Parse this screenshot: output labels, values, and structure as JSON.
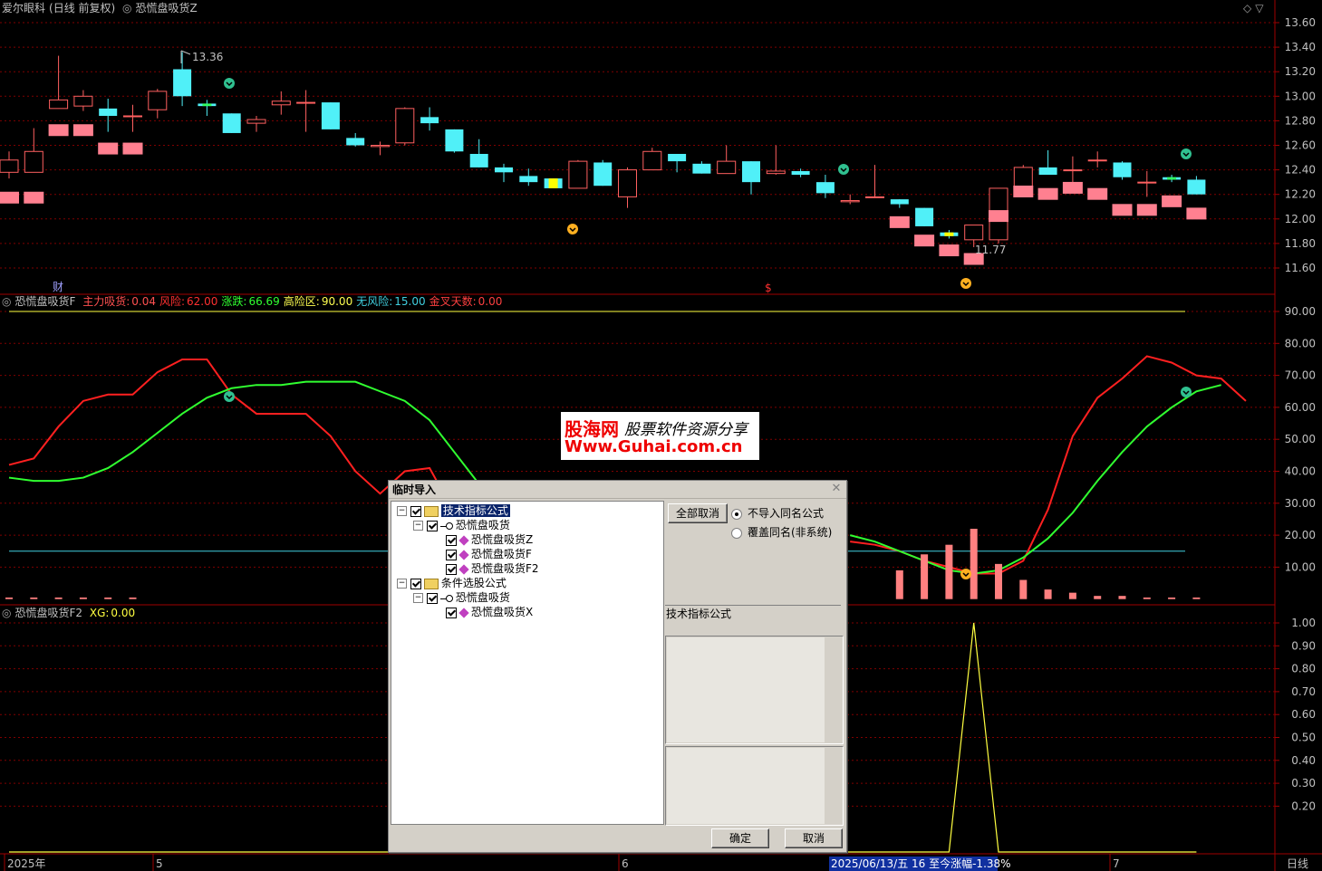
{
  "panel1": {
    "stock": "爱尔眼科",
    "mode": "(日线 前复权)",
    "indicator": "恐慌盘吸货Z",
    "high_label": "13.36",
    "low_label": "11.77",
    "marker_cai": "财",
    "marker_s": "$",
    "y_ticks": [
      "13.60",
      "13.40",
      "13.20",
      "13.00",
      "12.80",
      "12.60",
      "12.40",
      "12.20",
      "12.00",
      "11.80",
      "11.60"
    ]
  },
  "panel2": {
    "indicator": "恐慌盘吸货F",
    "items": [
      {
        "label": "主力吸货:",
        "value": "0.04",
        "color": "#ff5050"
      },
      {
        "label": "风险:",
        "value": "62.00",
        "color": "#ff3030"
      },
      {
        "label": "涨跌:",
        "value": "66.69",
        "color": "#30ff30"
      },
      {
        "label": "高险区:",
        "value": "90.00",
        "color": "#ffff50"
      },
      {
        "label": "无风险:",
        "value": "15.00",
        "color": "#40d0e0"
      },
      {
        "label": "金叉天数:",
        "value": "0.00",
        "color": "#ff4040"
      }
    ],
    "y_ticks": [
      "90.00",
      "80.00",
      "70.00",
      "60.00",
      "50.00",
      "40.00",
      "30.00",
      "20.00",
      "10.00"
    ]
  },
  "panel3": {
    "indicator": "恐慌盘吸货F2",
    "xg_label": "XG:",
    "xg_value": "0.00",
    "y_ticks": [
      "1.00",
      "0.90",
      "0.80",
      "0.70",
      "0.60",
      "0.50",
      "0.40",
      "0.30",
      "0.20"
    ]
  },
  "bottom": {
    "year": "2025年",
    "month5": "5",
    "month6": "6",
    "month7": "7",
    "status": "2025/06/13/五 16 至今涨幅-1.38%",
    "period": "日线"
  },
  "dialog": {
    "title": "临时导入",
    "tree": {
      "folder1": "技术指标公式",
      "group1": "恐慌盘吸货",
      "item1": "恐慌盘吸货Z",
      "item2": "恐慌盘吸货F",
      "item3": "恐慌盘吸货F2",
      "folder2": "条件选股公式",
      "group2": "恐慌盘吸货",
      "item4": "恐慌盘吸货X"
    },
    "cancel_all": "全部取消",
    "radio1": "不导入同名公式",
    "radio2": "覆盖同名(非系统)",
    "type_label": "技术指标公式",
    "ok": "确定",
    "cancel": "取消"
  },
  "watermark": {
    "brand": "股海网",
    "slogan": "股票软件资源分享",
    "url": "Www.Guhai.com.cn"
  },
  "colors": {
    "up": "#ff6060",
    "down": "#50f0f8",
    "red_line": "#ff2020",
    "green_line": "#30ff30",
    "yellow": "#ffff40",
    "grid": "#800000"
  },
  "chart_data": {
    "type": "candlestick",
    "candles": [
      {
        "o": 12.38,
        "c": 12.48,
        "h": 12.55,
        "l": 12.33,
        "s": 12.17
      },
      {
        "o": 12.38,
        "c": 12.55,
        "h": 12.74,
        "l": 12.38,
        "s": 12.17
      },
      {
        "o": 12.9,
        "c": 12.97,
        "h": 13.33,
        "l": 12.9,
        "s": 12.72
      },
      {
        "o": 12.92,
        "c": 13.0,
        "h": 13.05,
        "l": 12.88,
        "s": 12.72
      },
      {
        "o": 12.9,
        "c": 12.84,
        "h": 12.98,
        "l": 12.71,
        "s": 12.57
      },
      {
        "o": 12.84,
        "c": 12.84,
        "h": 12.93,
        "l": 12.71,
        "s": 12.57
      },
      {
        "o": 12.89,
        "c": 13.04,
        "h": 13.06,
        "l": 12.82,
        "s": null
      },
      {
        "o": 13.22,
        "c": 13.0,
        "h": 13.36,
        "l": 12.92,
        "s": null
      },
      {
        "o": 12.94,
        "c": 12.92,
        "h": 12.97,
        "l": 12.84,
        "s": null
      },
      {
        "o": 12.86,
        "c": 12.7,
        "h": 12.86,
        "l": 12.7,
        "s": null
      },
      {
        "o": 12.78,
        "c": 12.81,
        "h": 12.84,
        "l": 12.71,
        "s": null
      },
      {
        "o": 12.93,
        "c": 12.96,
        "h": 13.04,
        "l": 12.85,
        "s": null
      },
      {
        "o": 12.95,
        "c": 12.95,
        "h": 13.05,
        "l": 12.71,
        "s": null
      },
      {
        "o": 12.95,
        "c": 12.73,
        "h": 12.95,
        "l": 12.73,
        "s": null
      },
      {
        "o": 12.66,
        "c": 12.6,
        "h": 12.7,
        "l": 12.59,
        "s": null
      },
      {
        "o": 12.59,
        "c": 12.6,
        "h": 12.63,
        "l": 12.52,
        "s": null
      },
      {
        "o": 12.62,
        "c": 12.9,
        "h": 12.91,
        "l": 12.6,
        "s": null
      },
      {
        "o": 12.83,
        "c": 12.78,
        "h": 12.91,
        "l": 12.72,
        "s": null
      },
      {
        "o": 12.73,
        "c": 12.55,
        "h": 12.73,
        "l": 12.54,
        "s": null
      },
      {
        "o": 12.53,
        "c": 12.42,
        "h": 12.65,
        "l": 12.42,
        "s": null
      },
      {
        "o": 12.42,
        "c": 12.38,
        "h": 12.45,
        "l": 12.3,
        "s": null
      },
      {
        "o": 12.35,
        "c": 12.3,
        "h": 12.41,
        "l": 12.27,
        "s": null
      },
      {
        "o": 12.33,
        "c": 12.25,
        "h": 12.33,
        "l": 12.25,
        "s": null
      },
      {
        "o": 12.25,
        "c": 12.47,
        "h": 12.48,
        "l": 12.25,
        "s": null
      },
      {
        "o": 12.46,
        "c": 12.27,
        "h": 12.48,
        "l": 12.27,
        "s": null
      },
      {
        "o": 12.18,
        "c": 12.4,
        "h": 12.42,
        "l": 12.09,
        "s": null
      },
      {
        "o": 12.4,
        "c": 12.55,
        "h": 12.58,
        "l": 12.4,
        "s": null
      },
      {
        "o": 12.53,
        "c": 12.47,
        "h": 12.53,
        "l": 12.38,
        "s": null
      },
      {
        "o": 12.45,
        "c": 12.37,
        "h": 12.47,
        "l": 12.37,
        "s": null
      },
      {
        "o": 12.37,
        "c": 12.47,
        "h": 12.6,
        "l": 12.37,
        "s": null
      },
      {
        "o": 12.47,
        "c": 12.3,
        "h": 12.47,
        "l": 12.2,
        "s": null
      },
      {
        "o": 12.37,
        "c": 12.39,
        "h": 12.6,
        "l": 12.36,
        "s": null
      },
      {
        "o": 12.39,
        "c": 12.36,
        "h": 12.41,
        "l": 12.34,
        "s": null
      },
      {
        "o": 12.3,
        "c": 12.21,
        "h": 12.36,
        "l": 12.17,
        "s": null
      },
      {
        "o": 12.14,
        "c": 12.15,
        "h": 12.2,
        "l": 12.12,
        "s": null
      },
      {
        "o": 12.18,
        "c": 12.18,
        "h": 12.44,
        "l": 12.18,
        "s": null
      },
      {
        "o": 12.16,
        "c": 12.12,
        "h": 12.16,
        "l": 12.09,
        "s": 11.97
      },
      {
        "o": 12.09,
        "c": 11.94,
        "h": 12.09,
        "l": 11.94,
        "s": 11.82
      },
      {
        "o": 11.89,
        "c": 11.86,
        "h": 11.91,
        "l": 11.84,
        "s": 11.74
      },
      {
        "o": 11.83,
        "c": 11.95,
        "h": 11.95,
        "l": 11.77,
        "s": 11.67
      },
      {
        "o": 11.83,
        "c": 12.25,
        "h": 12.25,
        "l": 11.8,
        "s": 12.02
      },
      {
        "o": 12.22,
        "c": 12.42,
        "h": 12.44,
        "l": 12.22,
        "s": 12.22
      },
      {
        "o": 12.42,
        "c": 12.36,
        "h": 12.56,
        "l": 12.36,
        "s": 12.2
      },
      {
        "o": 12.4,
        "c": 12.4,
        "h": 12.51,
        "l": 12.26,
        "s": 12.25
      },
      {
        "o": 12.48,
        "c": 12.48,
        "h": 12.55,
        "l": 12.42,
        "s": 12.2
      },
      {
        "o": 12.46,
        "c": 12.34,
        "h": 12.47,
        "l": 12.32,
        "s": 12.07
      },
      {
        "o": 12.3,
        "c": 12.3,
        "h": 12.39,
        "l": 12.18,
        "s": 12.07
      },
      {
        "o": 12.34,
        "c": 12.32,
        "h": 12.36,
        "l": 12.3,
        "s": 12.14
      },
      {
        "o": 12.32,
        "c": 12.2,
        "h": 12.35,
        "l": 12.2,
        "s": 12.04
      }
    ],
    "red_line": [
      42,
      44,
      54,
      62,
      64,
      64,
      71,
      75,
      75,
      64,
      58,
      58,
      58,
      51,
      40,
      33,
      40,
      41,
      27,
      null,
      null,
      null,
      null,
      null,
      null,
      null,
      null,
      null,
      null,
      null,
      null,
      null,
      null,
      null,
      18,
      17,
      15,
      12,
      10,
      8,
      8,
      12,
      28,
      51,
      63,
      69,
      76,
      74,
      70,
      69,
      62
    ],
    "green_line": [
      38,
      37,
      37,
      38,
      41,
      46,
      52,
      58,
      63,
      66,
      67,
      67,
      68,
      68,
      68,
      65,
      62,
      56,
      46,
      36,
      null,
      null,
      null,
      null,
      null,
      null,
      null,
      null,
      null,
      null,
      null,
      null,
      null,
      null,
      20,
      18,
      15,
      12,
      9,
      8,
      9,
      13,
      19,
      27,
      37,
      46,
      54,
      60,
      65,
      67
    ],
    "bars": [
      0.5,
      0.5,
      0.5,
      0.5,
      0.5,
      0.5,
      null,
      null,
      null,
      null,
      null,
      null,
      null,
      null,
      null,
      null,
      null,
      null,
      null,
      null,
      null,
      null,
      null,
      null,
      null,
      null,
      null,
      null,
      null,
      null,
      null,
      null,
      null,
      null,
      null,
      null,
      9,
      14,
      17,
      22,
      11,
      6,
      3,
      2,
      1,
      1,
      0.5,
      0.5,
      0.5
    ],
    "xg": [
      0,
      0,
      0,
      0,
      0,
      0,
      0,
      0,
      0,
      0,
      0,
      0,
      0,
      0,
      0,
      0,
      0,
      0,
      0,
      0,
      0,
      0,
      0,
      0,
      0,
      0,
      0,
      0,
      0,
      0,
      0,
      0,
      0,
      0,
      0,
      0,
      0,
      0,
      0,
      1,
      0,
      0,
      0,
      0,
      0,
      0,
      0,
      0,
      0
    ],
    "levels": {
      "high_risk": 90,
      "no_risk": 15
    },
    "y1_range": [
      11.52,
      13.72
    ],
    "y2_range": [
      0,
      94
    ],
    "y3_range": [
      0,
      1.05
    ]
  }
}
